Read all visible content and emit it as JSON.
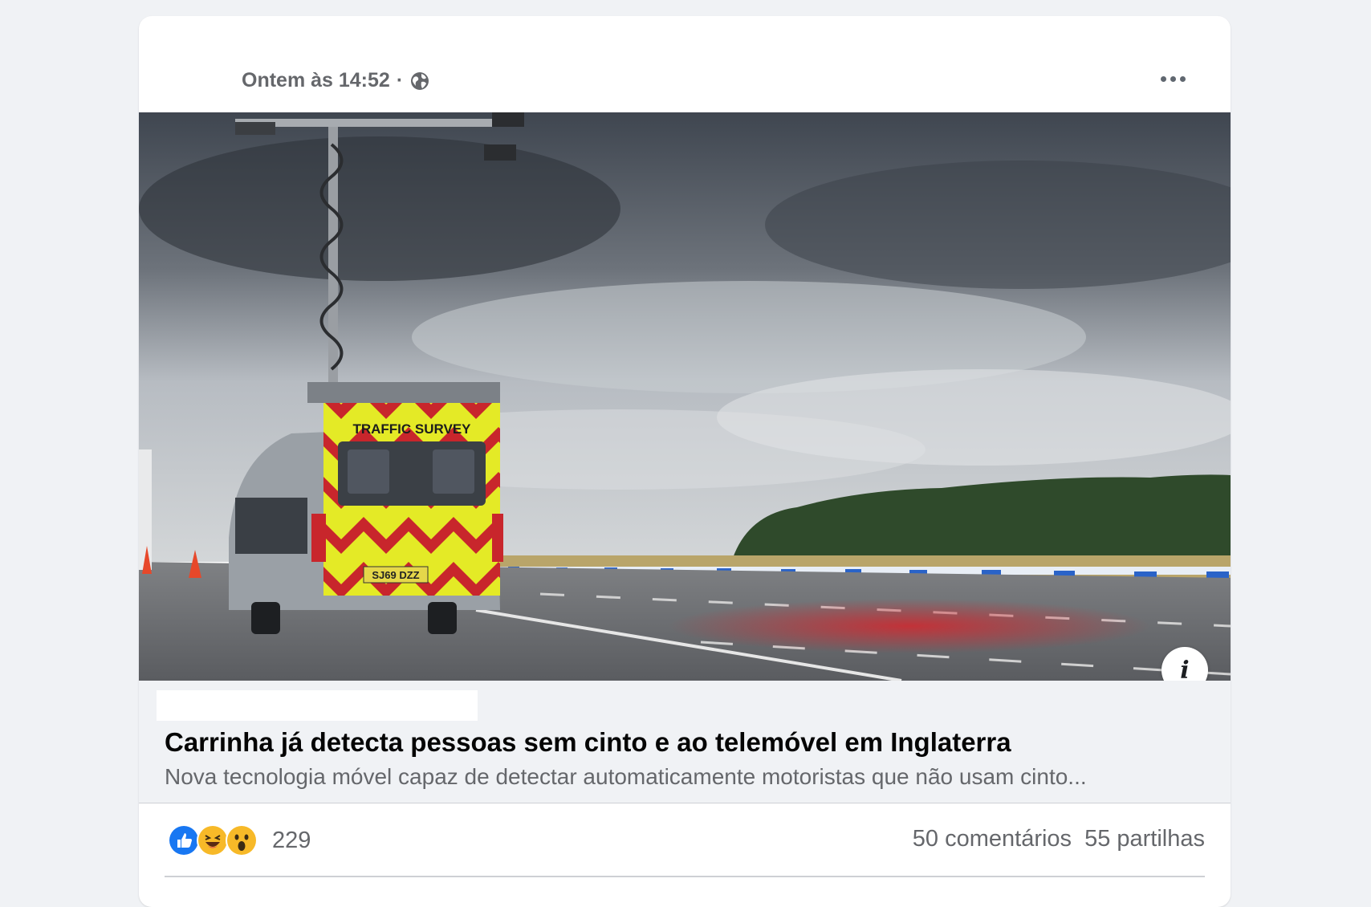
{
  "post": {
    "timestamp": "Ontem às 14:52",
    "separator": "·",
    "privacy_icon": "globe-icon",
    "more_icon": "more-options-icon"
  },
  "image": {
    "van_label": "TRAFFIC SURVEY",
    "plate": "SJ69 DZZ",
    "info_label": "i"
  },
  "link": {
    "title": "Carrinha já detecta pessoas sem cinto e ao telemóvel em Inglaterra",
    "description": "Nova tecnologia móvel capaz de detectar automaticamente motoristas que não usam cinto..."
  },
  "stats": {
    "reactions": [
      "like-icon",
      "haha-icon",
      "wow-icon"
    ],
    "reaction_count": "229",
    "comments": "50 comentários",
    "shares": "55 partilhas"
  },
  "colors": {
    "background": "#f0f2f5",
    "card": "#ffffff",
    "secondary_text": "#65676b",
    "like_blue": "#1877f2",
    "reaction_yellow": "#f7b928"
  }
}
